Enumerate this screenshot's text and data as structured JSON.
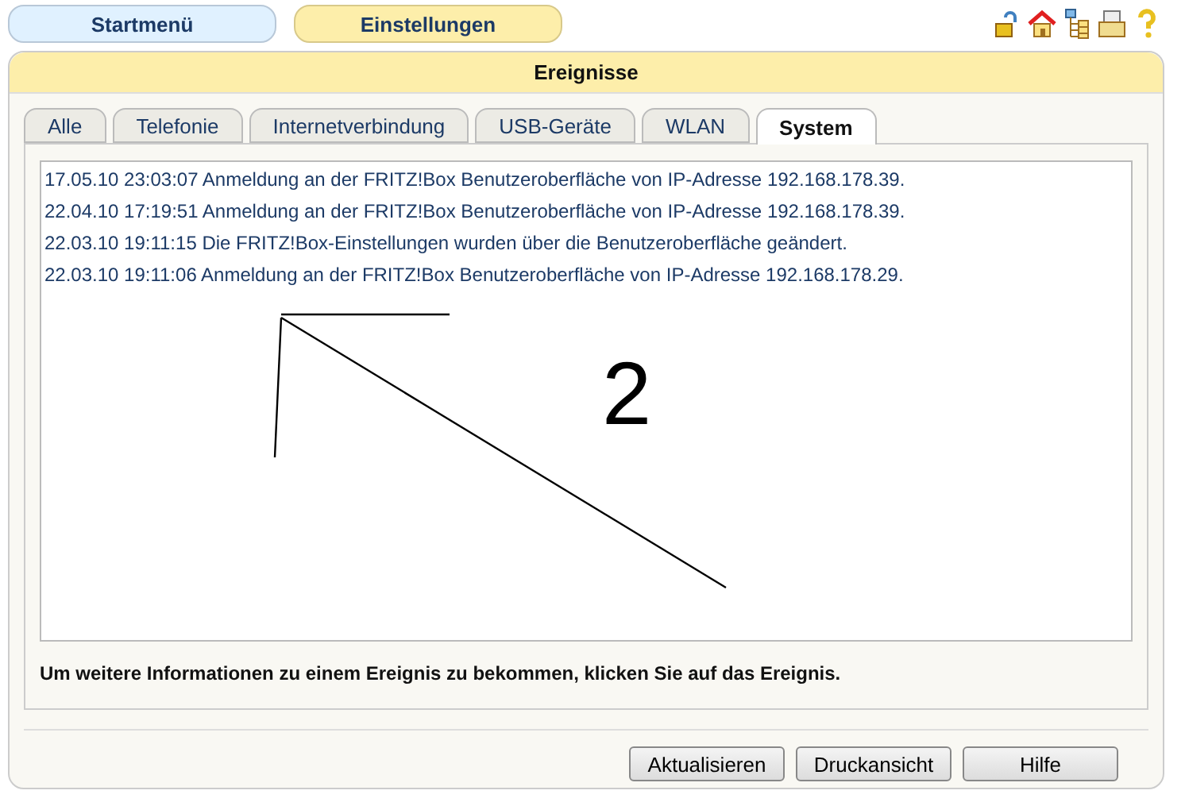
{
  "top_nav": [
    {
      "label": "Startmenü",
      "selected": false
    },
    {
      "label": "Einstellungen",
      "selected": true
    }
  ],
  "panel": {
    "title": "Ereignisse"
  },
  "tabs": [
    {
      "label": "Alle",
      "selected": false
    },
    {
      "label": "Telefonie",
      "selected": false
    },
    {
      "label": "Internetverbindung",
      "selected": false
    },
    {
      "label": "USB-Geräte",
      "selected": false
    },
    {
      "label": "WLAN",
      "selected": false
    },
    {
      "label": "System",
      "selected": true
    }
  ],
  "events": [
    "17.05.10 23:03:07 Anmeldung an der FRITZ!Box Benutzeroberfläche von IP-Adresse 192.168.178.39.",
    "22.04.10 17:19:51 Anmeldung an der FRITZ!Box Benutzeroberfläche von IP-Adresse 192.168.178.39.",
    "22.03.10 19:11:15 Die FRITZ!Box-Einstellungen wurden über die Benutzeroberfläche geändert.",
    "22.03.10 19:11:06 Anmeldung an der FRITZ!Box Benutzeroberfläche von IP-Adresse 192.168.178.29."
  ],
  "annotation": {
    "label": "2"
  },
  "info_text": "Um weitere Informationen zu einem Ereignis zu bekommen, klicken Sie auf das Ereignis.",
  "buttons": [
    "Aktualisieren",
    "Druckansicht",
    "Hilfe"
  ]
}
